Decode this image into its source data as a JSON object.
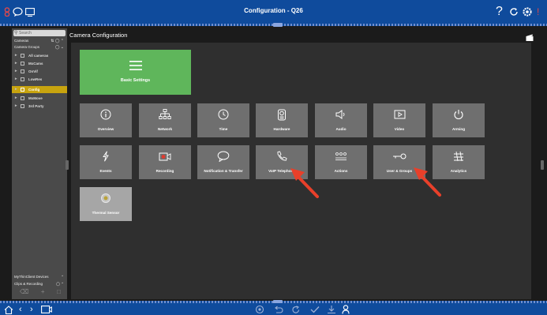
{
  "window": {
    "title": "Configuration - Q26"
  },
  "sidebar": {
    "search_placeholder": "Search",
    "cameras_label": "Cameras",
    "camera_groups_label": "Camera Groups",
    "groups": [
      {
        "label": "All cameras",
        "selected": false
      },
      {
        "label": "MxCams",
        "selected": false
      },
      {
        "label": "OnVif",
        "selected": false
      },
      {
        "label": "LowRes",
        "selected": false
      },
      {
        "label": "Config",
        "selected": true
      },
      {
        "label": "MxMove",
        "selected": false
      },
      {
        "label": "3rd Party",
        "selected": false
      }
    ],
    "footer": [
      {
        "label": "MyThinClient Devices"
      },
      {
        "label": "Clips & Recording"
      }
    ]
  },
  "main": {
    "heading": "Camera Configuration",
    "basic_settings": {
      "label": "Basic Settings",
      "icon": "menu-icon"
    },
    "row1": [
      {
        "label": "Overview",
        "icon": "info-icon"
      },
      {
        "label": "Network",
        "icon": "network-icon"
      },
      {
        "label": "Time",
        "icon": "clock-icon"
      },
      {
        "label": "Hardware",
        "icon": "hardware-icon"
      },
      {
        "label": "Audio",
        "icon": "speaker-icon"
      },
      {
        "label": "Video",
        "icon": "video-icon"
      },
      {
        "label": "Arming",
        "icon": "power-icon"
      }
    ],
    "row2": [
      {
        "label": "Events",
        "icon": "lightning-icon"
      },
      {
        "label": "Recording",
        "icon": "record-icon"
      },
      {
        "label": "Notification & Transfer",
        "icon": "speech-bubble-icon"
      },
      {
        "label": "VoIP Telephony",
        "icon": "phone-icon"
      },
      {
        "label": "Actions",
        "icon": "actions-icon"
      },
      {
        "label": "User & Groups",
        "icon": "key-icon"
      },
      {
        "label": "Analytics",
        "icon": "analytics-icon"
      }
    ],
    "thermal": {
      "label": "Thermal Sensor",
      "icon": "thermal-icon"
    }
  },
  "colors": {
    "titlebar": "#0f4b9c",
    "basic_tile": "#5fb65b",
    "tile": "#6f6f6f",
    "selected_group": "#c8a40f",
    "arrow": "#e8402a"
  }
}
